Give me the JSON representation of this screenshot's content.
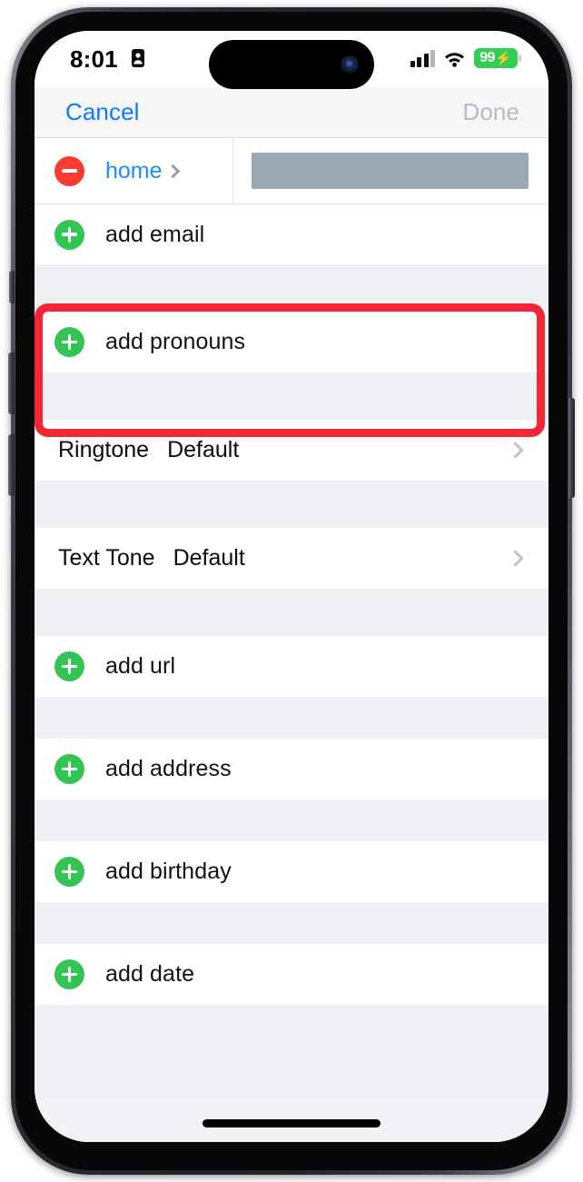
{
  "device": {
    "name": "iphone-14-pro"
  },
  "status_bar": {
    "time": "8:01",
    "location_icon": "location-arrow-icon",
    "signal_icon": "cellular-bars-icon",
    "wifi_icon": "wifi-icon",
    "battery_percent": "99",
    "battery_charging_glyph": "⚡"
  },
  "nav_bar": {
    "cancel_label": "Cancel",
    "done_label": "Done",
    "done_disabled": true
  },
  "highlight": {
    "color": "#f42534",
    "target": "phone-and-email-section"
  },
  "sections": [
    {
      "id": "contact-methods",
      "highlighted": true,
      "rows": [
        {
          "type": "labelled-field",
          "accessory": "minus",
          "key": "home",
          "key_color": "#1f8bff",
          "disclosure": "chevron-right-icon",
          "value": "",
          "redacted": true
        },
        {
          "type": "add",
          "accessory": "plus",
          "label": "add email"
        }
      ]
    },
    {
      "id": "pronouns",
      "rows": [
        {
          "type": "add",
          "accessory": "plus",
          "label": "add pronouns"
        }
      ]
    },
    {
      "id": "ringtone",
      "rows": [
        {
          "type": "value",
          "key": "Ringtone",
          "value": "Default",
          "disclosure": "chevron-right-icon"
        }
      ]
    },
    {
      "id": "text-tone",
      "rows": [
        {
          "type": "value",
          "key": "Text Tone",
          "value": "Default",
          "disclosure": "chevron-right-icon"
        }
      ]
    },
    {
      "id": "url",
      "rows": [
        {
          "type": "add",
          "accessory": "plus",
          "label": "add url"
        }
      ]
    },
    {
      "id": "address",
      "rows": [
        {
          "type": "add",
          "accessory": "plus",
          "label": "add address"
        }
      ]
    },
    {
      "id": "birthday",
      "rows": [
        {
          "type": "add",
          "accessory": "plus",
          "label": "add birthday"
        }
      ]
    },
    {
      "id": "date",
      "rows": [
        {
          "type": "add",
          "accessory": "plus",
          "label": "add date"
        }
      ]
    }
  ],
  "colors": {
    "accent_blue": "#0a7bff",
    "add_green": "#32c552",
    "remove_red": "#fa3b2f",
    "highlight_red": "#f42534",
    "group_background": "#eff0f4",
    "redacted_gray": "#9aa8b4",
    "battery_green": "#32cd53"
  }
}
